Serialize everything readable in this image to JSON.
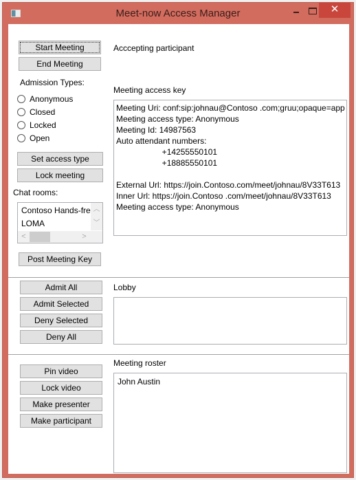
{
  "window": {
    "title": "Meet-now Access Manager",
    "controls": {
      "minimize": "–",
      "maximize": "□",
      "close": "✕"
    }
  },
  "meeting_section": {
    "start_meeting_label": "Start Meeting",
    "end_meeting_label": "End Meeting",
    "admission_types_label": "Admission Types:",
    "admission_types": [
      "Anonymous",
      "Closed",
      "Locked",
      "Open"
    ],
    "set_access_type_label": "Set access type",
    "lock_meeting_label": "Lock meeting",
    "chat_rooms_label": "Chat rooms:",
    "chat_rooms": [
      "Contoso Hands-fre",
      "LOMA"
    ],
    "post_meeting_key_label": "Post Meeting Key",
    "status_text": "Acccepting participant",
    "access_key_label": "Meeting access key",
    "access_key_text": "Meeting Uri: conf:sip:johnau@Contoso .com;gruu;opaque=app\nMeeting access type: Anonymous\nMeeting Id: 14987563\nAuto attendant numbers:\n                    +14255550101\n                    +18885550101\n\nExternal Url: https://join.Contoso.com/meet/johnau/8V33T613\nInner Url: https://join.Contoso .com/meet/johnau/8V33T613\nMeeting access type: Anonymous"
  },
  "lobby_section": {
    "admit_all_label": "Admit All",
    "admit_selected_label": "Admit Selected",
    "deny_selected_label": "Deny Selected",
    "deny_all_label": "Deny All",
    "lobby_label": "Lobby",
    "lobby_items": []
  },
  "roster_section": {
    "pin_video_label": "Pin video",
    "lock_video_label": "Lock video",
    "make_presenter_label": "Make presenter",
    "make_participant_label": "Make participant",
    "roster_label": "Meeting roster",
    "roster_items": [
      "John Austin"
    ]
  },
  "scroll_glyphs": {
    "up": "︿",
    "down": "﹀",
    "left": "<",
    "right": ">"
  }
}
